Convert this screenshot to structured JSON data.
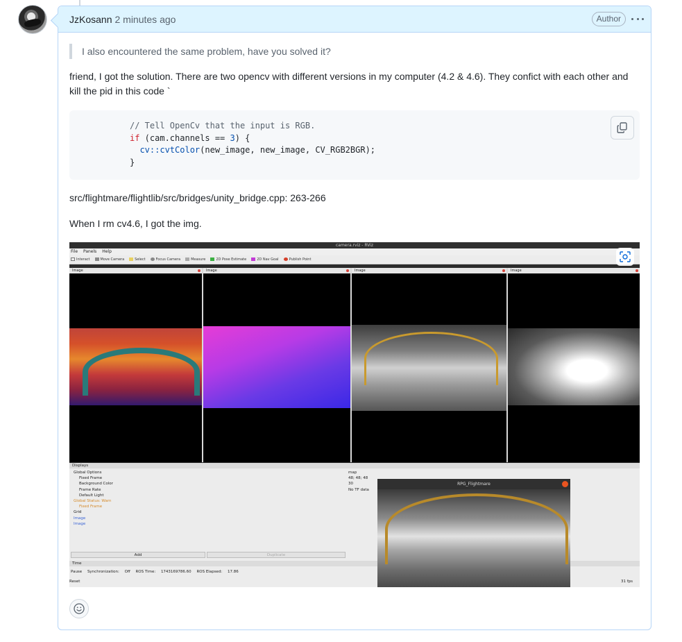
{
  "comment": {
    "author": "JzKosann",
    "time": "2 minutes ago",
    "badge": "Author",
    "quote": "I also encountered the same problem, have you solved it?",
    "para1": "friend, I got the solution. There are two opencv with different versions in my computer (4.2 & 4.6). They confict with each other and kill the pid in this code `",
    "code": {
      "line1": "// Tell OpenCv that the input is RGB.",
      "line2_kw": "if",
      "line2_a": " (cam.channels == ",
      "line2_num": "3",
      "line2_b": ") {",
      "line3_fn": "cv::cvtColor",
      "line3_rest": "(new_image, new_image, CV_RGB2BGR);",
      "line4": "}"
    },
    "path": "src/flightmare/flightlib/src/bridges/unity_bridge.cpp: 263-266",
    "para3": "When I rm cv4.6, I got the img."
  },
  "screenshot": {
    "title": "camera.rviz - RViz",
    "menu": [
      "File",
      "Panels",
      "Help"
    ],
    "tools": [
      "Interact",
      "Move Camera",
      "Select",
      "Focus Camera",
      "Measure",
      "2D Pose Estimate",
      "2D Nav Goal",
      "Publish Point"
    ],
    "pane_label": "Image",
    "displays_label": "Displays",
    "tree": [
      "Global Options",
      "Fixed Frame",
      "Background Color",
      "Frame Rate",
      "Default Light",
      "Global Status: Warn",
      "Fixed Frame",
      "Grid",
      "Image",
      "Image"
    ],
    "values": [
      "map",
      "48; 48; 48",
      "30",
      "",
      "",
      "No TF data"
    ],
    "add_label": "Add",
    "duplicate_label": "Duplicate",
    "time_label": "Time",
    "pause_label": "Pause",
    "sync_label": "Synchronization:",
    "sync_value": "Off",
    "ros_time_label": "ROS Time:",
    "ros_time_value": "1743169786.60",
    "ros_elapsed_label": "ROS Elapsed:",
    "ros_elapsed_value": "17.86",
    "reset_label": "Reset",
    "fps": "31 fps",
    "flight_title": "RPG_Flightmare"
  },
  "colors": {
    "header_bg": "#ddf4ff",
    "border": "#b6d5f7",
    "code_bg": "#f6f8fa"
  },
  "icons": [
    "avatar",
    "kebab-menu-icon",
    "copy-icon",
    "lens-icon",
    "smiley-icon"
  ]
}
